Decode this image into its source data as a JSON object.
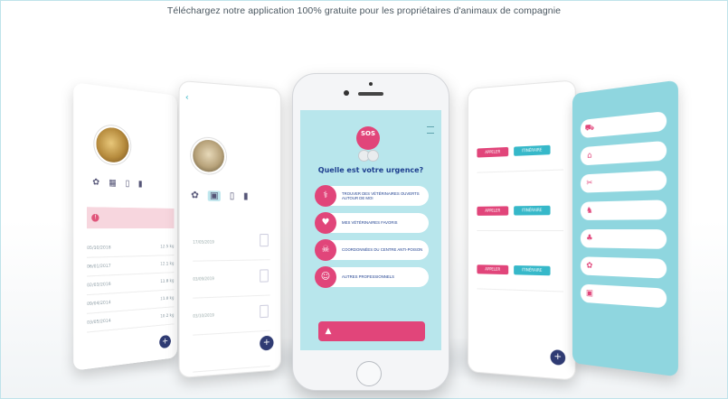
{
  "headline": "Téléchargez notre application 100% gratuite pour les propriétaires d'animaux de compagnie",
  "colors": {
    "accent_pink": "#e1457a",
    "accent_teal": "#36b8c9",
    "bg_teal": "#b8e6ec",
    "navy": "#1e3f8f"
  },
  "phone1": {
    "icons": [
      "paw-icon",
      "calendar-icon",
      "document-icon",
      "bottle-icon"
    ],
    "alert_icon": "!",
    "rows": [
      {
        "date": "05/10/2018",
        "value": "12.5 kg"
      },
      {
        "date": "06/01/2017",
        "value": "12.1 kg"
      },
      {
        "date": "02/03/2016",
        "value": "11.8 kg"
      },
      {
        "date": "09/04/2014",
        "value": "11.0 kg"
      },
      {
        "date": "03/05/2014",
        "value": "10.2 kg"
      }
    ],
    "fab": "+"
  },
  "phone2": {
    "icons": [
      "paw-icon",
      "medical-kit-icon",
      "document-icon",
      "bottle-icon"
    ],
    "items": [
      {
        "date": "17/05/2019"
      },
      {
        "date": "03/09/2019"
      },
      {
        "date": "03/10/2019"
      },
      {
        "date": ""
      }
    ],
    "fab": "+"
  },
  "phone3": {
    "logo_top": "SOS",
    "question": "Quelle est votre urgence?",
    "buttons": [
      {
        "icon": "stethoscope-icon",
        "glyph": "⚕",
        "label": "TROUVER DES VÉTÉRINAIRES OUVERTS AUTOUR DE MOI"
      },
      {
        "icon": "heart-icon",
        "glyph": "♥",
        "label": "MES VÉTÉRINAIRES FAVORIS"
      },
      {
        "icon": "antipoison-icon",
        "glyph": "☠",
        "label": "COORDONNÉES DU CENTRE ANTI-POISON"
      },
      {
        "icon": "professional-icon",
        "glyph": "☺",
        "label": "AUTRES PROFESSIONNELS"
      }
    ],
    "emergency_icon": "siren-icon"
  },
  "phone4": {
    "vets": [
      {
        "call": "APPELER",
        "route": "ITINÉRAIRE"
      },
      {
        "call": "APPELER",
        "route": "ITINÉRAIRE"
      },
      {
        "call": "APPELER",
        "route": "ITINÉRAIRE"
      }
    ],
    "fab": "+"
  },
  "phone5": {
    "items": [
      {
        "icon": "van-icon",
        "glyph": "⛟"
      },
      {
        "icon": "house-icon",
        "glyph": "⌂"
      },
      {
        "icon": "scissors-icon",
        "glyph": "✂"
      },
      {
        "icon": "dog-icon",
        "glyph": "♞"
      },
      {
        "icon": "cat-icon",
        "glyph": "♣"
      },
      {
        "icon": "food-icon",
        "glyph": "✿"
      },
      {
        "icon": "bag-icon",
        "glyph": "▣"
      }
    ]
  }
}
